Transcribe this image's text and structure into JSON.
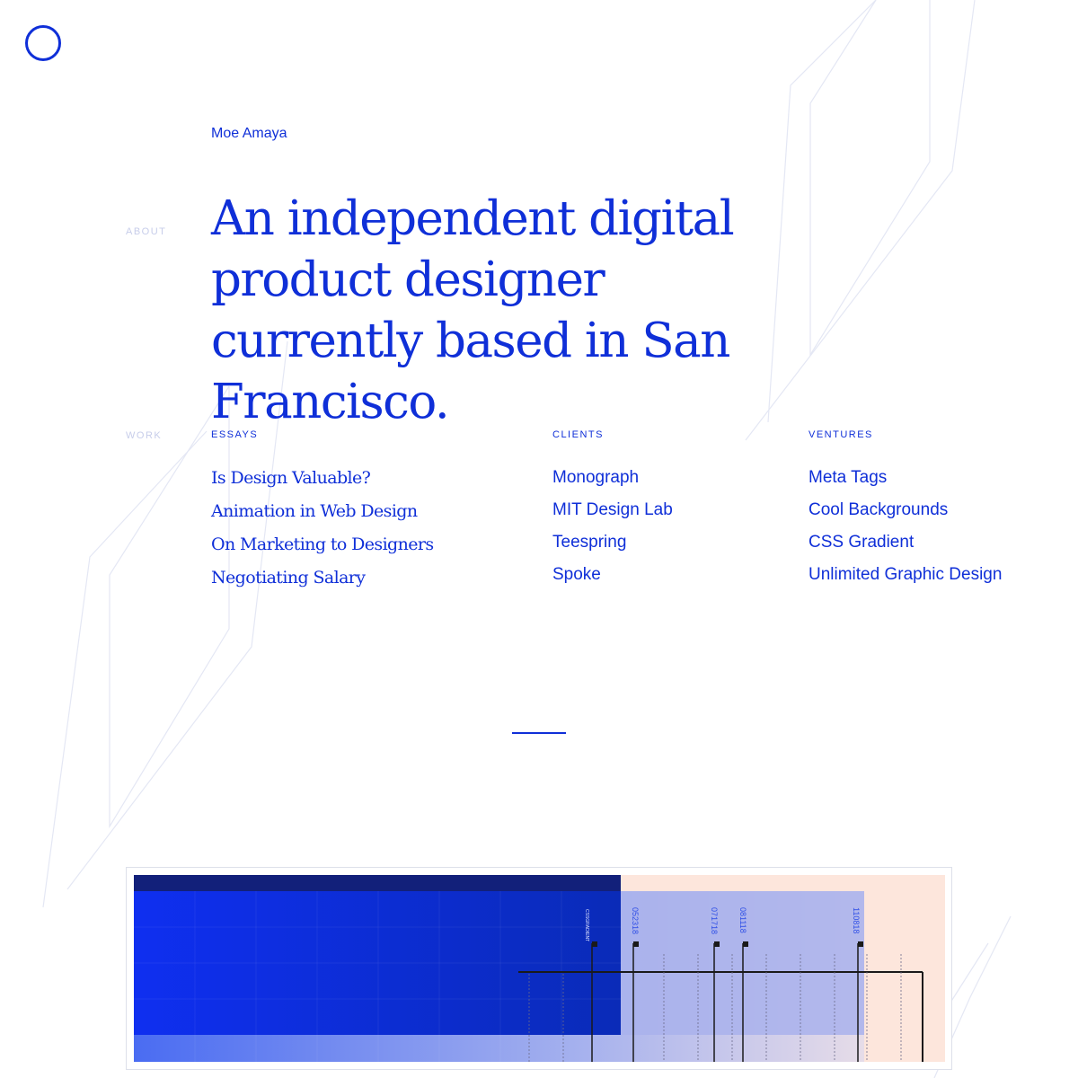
{
  "header": {
    "site_name": "Moe Amaya"
  },
  "about": {
    "label": "ABOUT",
    "headline": "An independent digital product designer currently based in San Francisco."
  },
  "work": {
    "label": "WORK",
    "columns": [
      {
        "heading": "ESSAYS",
        "items": [
          "Is Design Valuable?",
          "Animation in Web Design",
          "On Marketing to Designers",
          "Negotiating Salary"
        ]
      },
      {
        "heading": "CLIENTS",
        "items": [
          "Monograph",
          "MIT Design Lab",
          "Teespring",
          "Spoke"
        ]
      },
      {
        "heading": "VENTURES",
        "items": [
          "Meta Tags",
          "Cool Backgrounds",
          "CSS Gradient",
          "Unlimited Graphic Design"
        ]
      }
    ]
  },
  "preview": {
    "markers": [
      "CSSGRADIENT",
      "052318",
      "071718",
      "081118",
      "110818"
    ]
  },
  "colors": {
    "accent": "#0f2fd8",
    "muted_label": "#c7cdea",
    "peach": "#fde6dc",
    "navy": "#12207a"
  }
}
